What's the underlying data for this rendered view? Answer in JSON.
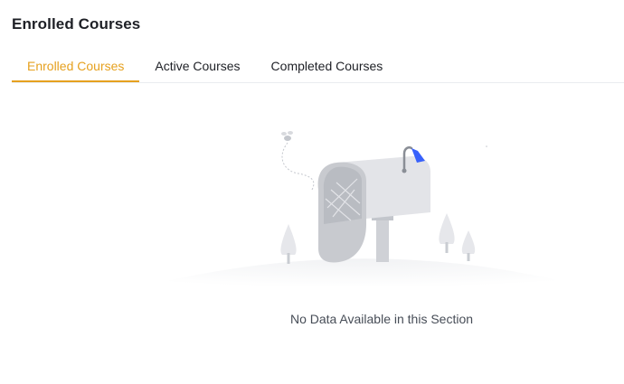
{
  "page": {
    "title": "Enrolled Courses"
  },
  "tabs": [
    {
      "label": "Enrolled Courses",
      "active": true
    },
    {
      "label": "Active Courses",
      "active": false
    },
    {
      "label": "Completed Courses",
      "active": false
    }
  ],
  "empty_state": {
    "illustration": "mailbox-empty-illustration",
    "message": "No Data Available in this Section"
  },
  "colors": {
    "accent": "#e6a11f",
    "flag": "#3861fb"
  }
}
